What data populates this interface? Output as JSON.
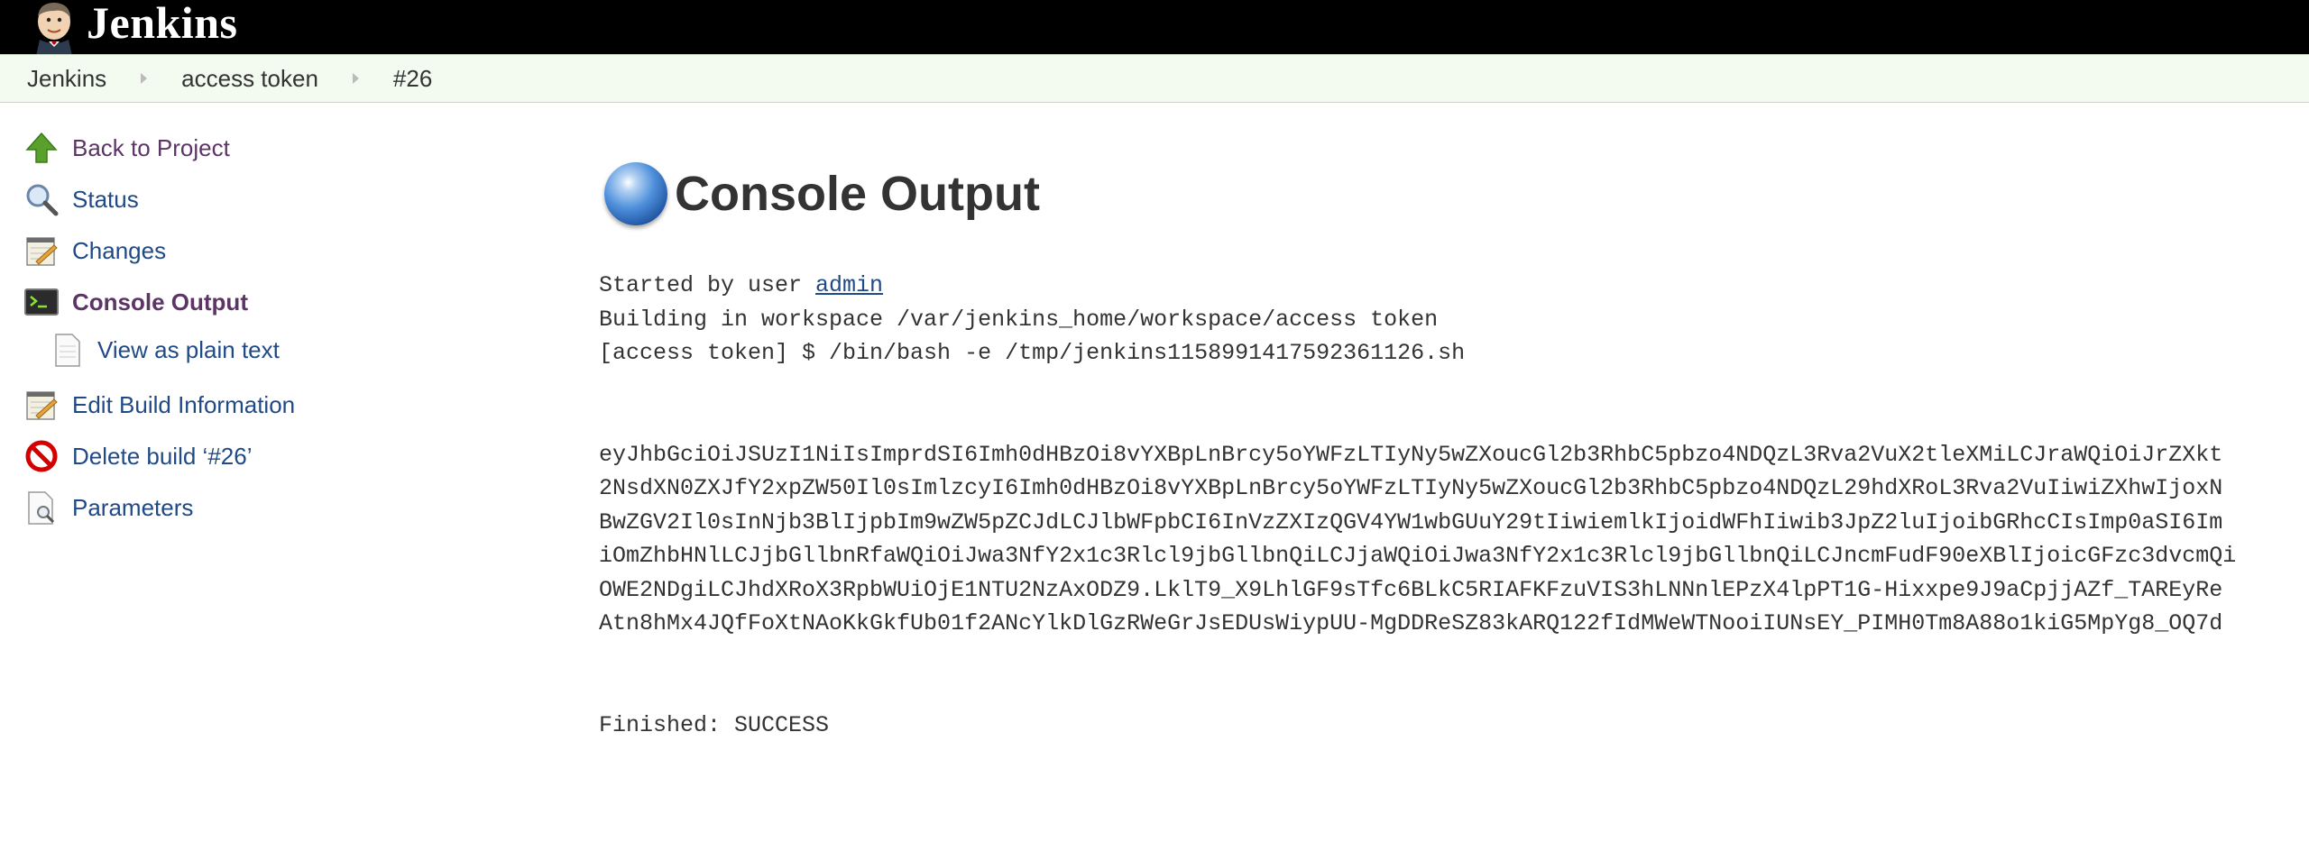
{
  "header": {
    "app_name": "Jenkins"
  },
  "breadcrumb": [
    {
      "label": "Jenkins"
    },
    {
      "label": "access token"
    },
    {
      "label": "#26"
    }
  ],
  "sidebar": {
    "items": [
      {
        "label": "Back to Project",
        "icon": "up-arrow-icon"
      },
      {
        "label": "Status",
        "icon": "magnifier-icon"
      },
      {
        "label": "Changes",
        "icon": "notepad-icon"
      },
      {
        "label": "Console Output",
        "icon": "terminal-icon"
      },
      {
        "label": "View as plain text",
        "icon": "document-icon"
      },
      {
        "label": "Edit Build Information",
        "icon": "notepad-icon"
      },
      {
        "label": "Delete build ‘#26’",
        "icon": "no-entry-icon"
      },
      {
        "label": "Parameters",
        "icon": "document-search-icon"
      }
    ]
  },
  "main": {
    "title": "Console Output",
    "started_prefix": "Started by user ",
    "started_user": "admin",
    "workspace_line": "Building in workspace /var/jenkins_home/workspace/access token",
    "command_line": "[access token] $ /bin/bash -e /tmp/jenkins1158991417592361126.sh",
    "token_lines": [
      "eyJhbGciOiJSUzI1NiIsImprdSI6Imh0dHBzOi8vYXBpLnBrcy5oYWFzLTIyNy5wZXoucGl2b3RhbC5pbzo4NDQzL3Rva2VuX2tleXMiLCJraWQiOiJrZXkt",
      "2NsdXN0ZXJfY2xpZW50Il0sImlzcyI6Imh0dHBzOi8vYXBpLnBrcy5oYWFzLTIyNy5wZXoucGl2b3RhbC5pbzo4NDQzL29hdXRoL3Rva2VuIiwiZXhwIjoxN",
      "BwZGV2Il0sInNjb3BlIjpbIm9wZW5pZCJdLCJlbWFpbCI6InVzZXIzQGV4YW1wbGUuY29tIiwiemlkIjoidWFhIiwib3JpZ2luIjoibGRhcCIsImp0aSI6Im",
      "iOmZhbHNlLCJjbGllbnRfaWQiOiJwa3NfY2x1c3Rlcl9jbGllbnQiLCJjaWQiOiJwa3NfY2x1c3Rlcl9jbGllbnQiLCJncmFudF90eXBlIjoicGFzc3dvcmQi",
      "OWE2NDgiLCJhdXRoX3RpbWUiOjE1NTU2NzAxODZ9.LklT9_X9LhlGF9sTfc6BLkC5RIAFKFzuVIS3hLNNnlEPzX4lpPT1G-Hixxpe9J9aCpjjAZf_TAREyRe",
      "Atn8hMx4JQfFoXtNAoKkGkfUb01f2ANcYlkDlGzRWeGrJsEDUsWiypUU-MgDDReSZ83kARQ122fIdMWeWTNooiIUNsEY_PIMH0Tm8A88o1kiG5MpYg8_OQ7d"
    ],
    "finished_line": "Finished: SUCCESS"
  }
}
